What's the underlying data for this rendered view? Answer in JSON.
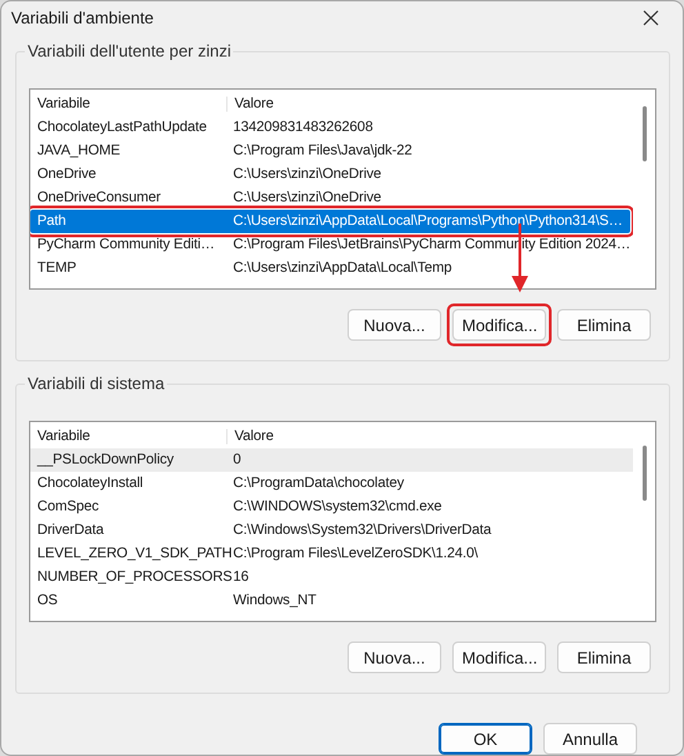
{
  "window": {
    "title": "Variabili d'ambiente"
  },
  "groups": [
    {
      "title": "Variabili dell'utente per zinzi",
      "focused": true,
      "columns": [
        "Variabile",
        "Valore"
      ],
      "rows": [
        {
          "name": "ChocolateyLastPathUpdate",
          "value": "134209831483262608",
          "selected": false,
          "highlighted": false
        },
        {
          "name": "JAVA_HOME",
          "value": "C:\\Program Files\\Java\\jdk-22",
          "selected": false,
          "highlighted": false
        },
        {
          "name": "OneDrive",
          "value": "C:\\Users\\zinzi\\OneDrive",
          "selected": false,
          "highlighted": false
        },
        {
          "name": "OneDriveConsumer",
          "value": "C:\\Users\\zinzi\\OneDrive",
          "selected": false,
          "highlighted": false
        },
        {
          "name": "Path",
          "value": "C:\\Users\\zinzi\\AppData\\Local\\Programs\\Python\\Python314\\S…",
          "selected": true,
          "highlighted": true
        },
        {
          "name": "PyCharm Community Editi…",
          "value": "C:\\Program Files\\JetBrains\\PyCharm Community Edition 2024…",
          "selected": false,
          "highlighted": false
        },
        {
          "name": "TEMP",
          "value": "C:\\Users\\zinzi\\AppData\\Local\\Temp",
          "selected": false,
          "highlighted": false
        }
      ],
      "buttons": [
        {
          "label": "Nuova...",
          "highlighted": false
        },
        {
          "label": "Modifica...",
          "highlighted": true
        },
        {
          "label": "Elimina",
          "highlighted": false
        }
      ]
    },
    {
      "title": "Variabili di sistema",
      "focused": false,
      "columns": [
        "Variabile",
        "Valore"
      ],
      "rows": [
        {
          "name": "__PSLockDownPolicy",
          "value": "0",
          "selected": true,
          "highlighted": false
        },
        {
          "name": "ChocolateyInstall",
          "value": "C:\\ProgramData\\chocolatey",
          "selected": false,
          "highlighted": false
        },
        {
          "name": "ComSpec",
          "value": "C:\\WINDOWS\\system32\\cmd.exe",
          "selected": false,
          "highlighted": false
        },
        {
          "name": "DriverData",
          "value": "C:\\Windows\\System32\\Drivers\\DriverData",
          "selected": false,
          "highlighted": false
        },
        {
          "name": "LEVEL_ZERO_V1_SDK_PATH",
          "value": "C:\\Program Files\\LevelZeroSDK\\1.24.0\\",
          "selected": false,
          "highlighted": false
        },
        {
          "name": "NUMBER_OF_PROCESSORS",
          "value": "16",
          "selected": false,
          "highlighted": false
        },
        {
          "name": "OS",
          "value": "Windows_NT",
          "selected": false,
          "highlighted": false
        }
      ],
      "buttons": [
        {
          "label": "Nuova...",
          "highlighted": false
        },
        {
          "label": "Modifica...",
          "highlighted": false
        },
        {
          "label": "Elimina",
          "highlighted": false
        }
      ]
    }
  ],
  "footer_buttons": [
    {
      "label": "OK",
      "default": true
    },
    {
      "label": "Annulla",
      "default": false
    }
  ]
}
